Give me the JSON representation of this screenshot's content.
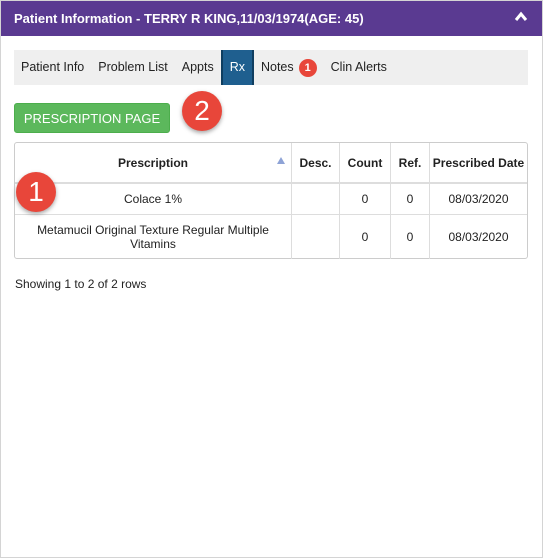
{
  "header": {
    "title": "Patient Information - TERRY R KING,11/03/1974(AGE: 45)",
    "collapse_icon": "chevron-up-icon",
    "color": "#5a3a91"
  },
  "tabs": [
    {
      "label": "Patient Info"
    },
    {
      "label": "Problem List"
    },
    {
      "label": "Appts"
    },
    {
      "label": "Rx",
      "active": true
    },
    {
      "label": "Notes",
      "badge": "1"
    },
    {
      "label": "Clin Alerts"
    }
  ],
  "prescription_button": {
    "label": "PRESCRIPTION PAGE",
    "color": "#5cb85c"
  },
  "markers": {
    "one": "1",
    "two": "2",
    "color": "#e8463a"
  },
  "table": {
    "columns": [
      "Prescription",
      "Desc.",
      "Count",
      "Ref.",
      "Prescribed Date"
    ],
    "sort_icon": "sort-ascending-icon",
    "rows": [
      {
        "prescription": "Colace 1%",
        "desc": "",
        "count": "0",
        "ref": "0",
        "date": "08/03/2020"
      },
      {
        "prescription": "Metamucil Original Texture Regular Multiple Vitamins",
        "desc": "",
        "count": "0",
        "ref": "0",
        "date": "08/03/2020"
      }
    ]
  },
  "pagination": {
    "summary": "Showing 1 to 2 of 2 rows"
  }
}
